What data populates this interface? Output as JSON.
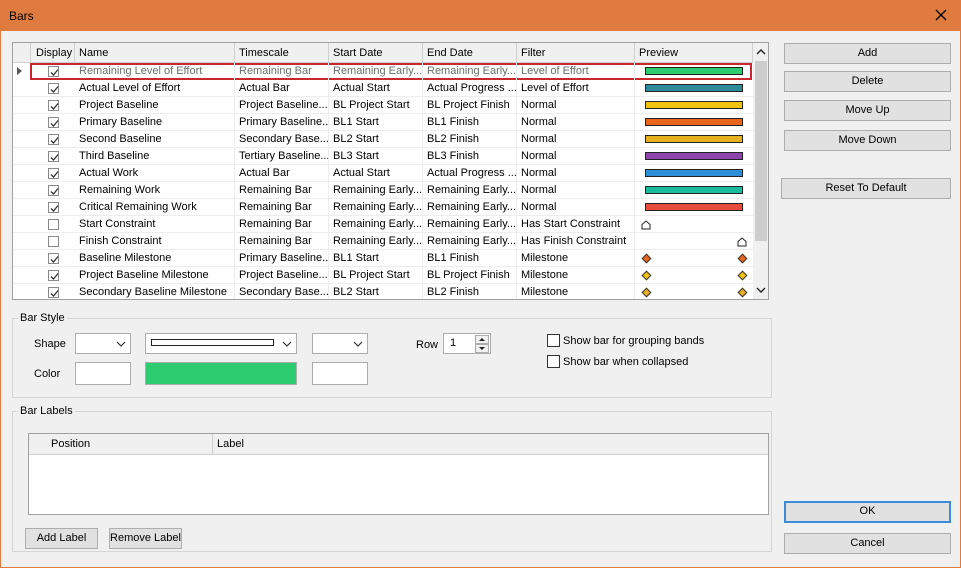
{
  "window": {
    "title": "Bars"
  },
  "grid": {
    "columns": [
      "Display",
      "Name",
      "Timescale",
      "Start Date",
      "End Date",
      "Filter",
      "Preview"
    ],
    "rows": [
      {
        "display": true,
        "name": "Remaining Level of Effort",
        "timescale": "Remaining Bar",
        "start": "Remaining Early...",
        "end": "Remaining Early...",
        "filter": "Level of Effort",
        "preview": {
          "kind": "bar",
          "color": "#2ecc71"
        },
        "selected": true
      },
      {
        "display": true,
        "name": "Actual Level of Effort",
        "timescale": "Actual Bar",
        "start": "Actual Start",
        "end": "Actual Progress ...",
        "filter": "Level of Effort",
        "preview": {
          "kind": "bar",
          "color": "#2e8b9a"
        }
      },
      {
        "display": true,
        "name": "Project Baseline",
        "timescale": "Project Baseline...",
        "start": "BL Project Start",
        "end": "BL Project Finish",
        "filter": "Normal",
        "preview": {
          "kind": "bar",
          "color": "#f1c40f"
        }
      },
      {
        "display": true,
        "name": "Primary Baseline",
        "timescale": "Primary Baseline...",
        "start": "BL1 Start",
        "end": "BL1 Finish",
        "filter": "Normal",
        "preview": {
          "kind": "bar",
          "color": "#e8661c"
        }
      },
      {
        "display": true,
        "name": "Second Baseline",
        "timescale": "Secondary Base...",
        "start": "BL2 Start",
        "end": "BL2 Finish",
        "filter": "Normal",
        "preview": {
          "kind": "bar",
          "color": "#e6b020"
        }
      },
      {
        "display": true,
        "name": "Third Baseline",
        "timescale": "Tertiary Baseline...",
        "start": "BL3 Start",
        "end": "BL3 Finish",
        "filter": "Normal",
        "preview": {
          "kind": "bar",
          "color": "#8e44ad"
        }
      },
      {
        "display": true,
        "name": "Actual Work",
        "timescale": "Actual Bar",
        "start": "Actual Start",
        "end": "Actual Progress ...",
        "filter": "Normal",
        "preview": {
          "kind": "bar",
          "color": "#2d8fd5"
        }
      },
      {
        "display": true,
        "name": "Remaining Work",
        "timescale": "Remaining Bar",
        "start": "Remaining Early...",
        "end": "Remaining Early...",
        "filter": "Normal",
        "preview": {
          "kind": "bar",
          "color": "#1abc9c"
        }
      },
      {
        "display": true,
        "name": "Critical Remaining Work",
        "timescale": "Remaining Bar",
        "start": "Remaining Early...",
        "end": "Remaining Early...",
        "filter": "Normal",
        "preview": {
          "kind": "bar",
          "color": "#e74c3c"
        }
      },
      {
        "display": false,
        "name": "Start Constraint",
        "timescale": "Remaining Bar",
        "start": "Remaining Early...",
        "end": "Remaining Early...",
        "filter": "Has Start Constraint",
        "preview": {
          "kind": "start-constraint",
          "color": "#ffffff"
        }
      },
      {
        "display": false,
        "name": "Finish Constraint",
        "timescale": "Remaining Bar",
        "start": "Remaining Early...",
        "end": "Remaining Early...",
        "filter": "Has Finish Constraint",
        "preview": {
          "kind": "finish-constraint",
          "color": "#ffffff"
        }
      },
      {
        "display": true,
        "name": "Baseline Milestone",
        "timescale": "Primary Baseline...",
        "start": "BL1 Start",
        "end": "BL1 Finish",
        "filter": "Milestone",
        "preview": {
          "kind": "milestone",
          "color": "#e8661c"
        }
      },
      {
        "display": true,
        "name": "Project Baseline Milestone",
        "timescale": "Project Baseline...",
        "start": "BL Project Start",
        "end": "BL Project Finish",
        "filter": "Milestone",
        "preview": {
          "kind": "milestone",
          "color": "#f1c40f"
        }
      },
      {
        "display": true,
        "name": "Secondary Baseline Milestone",
        "timescale": "Secondary Base...",
        "start": "BL2 Start",
        "end": "BL2 Finish",
        "filter": "Milestone",
        "preview": {
          "kind": "milestone",
          "color": "#e6b020"
        }
      }
    ]
  },
  "buttons": {
    "add": "Add",
    "delete": "Delete",
    "move_up": "Move Up",
    "move_down": "Move Down",
    "reset": "Reset To Default",
    "ok": "OK",
    "cancel": "Cancel"
  },
  "bar_style": {
    "title": "Bar Style",
    "shape_label": "Shape",
    "color_label": "Color",
    "row_label": "Row",
    "row_value": "1",
    "bar_color": "#2ecc71",
    "show_grouping": {
      "label": "Show bar for grouping bands",
      "checked": false
    },
    "show_collapsed": {
      "label": "Show bar when collapsed",
      "checked": false
    }
  },
  "bar_labels": {
    "title": "Bar Labels",
    "columns": [
      "Position",
      "Label"
    ],
    "add_label": "Add Label",
    "remove_label": "Remove Label"
  }
}
